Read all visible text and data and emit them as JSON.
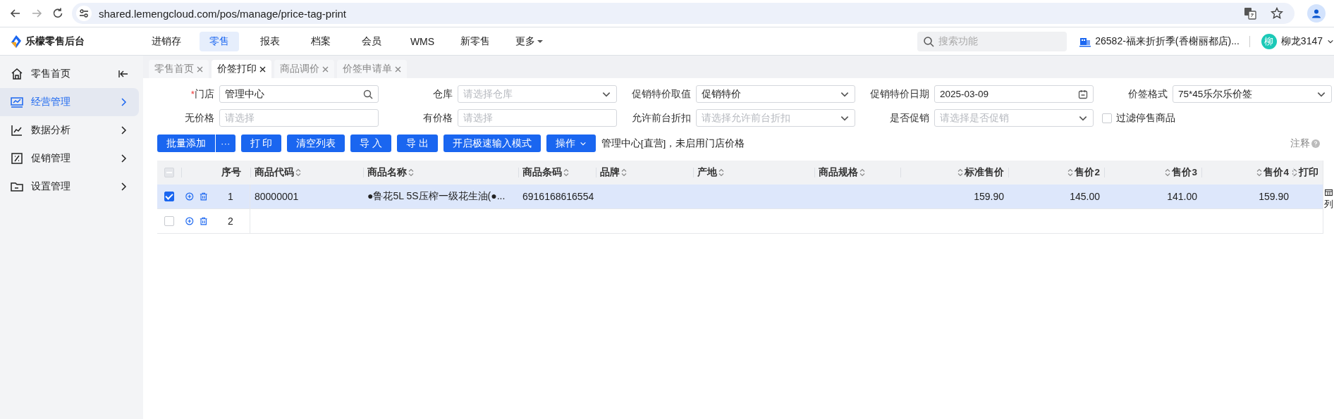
{
  "browser": {
    "url": "shared.lemengcloud.com/pos/manage/price-tag-print"
  },
  "header": {
    "brand": "乐檬零售后台",
    "nav": [
      {
        "label": "进销存",
        "selected": false,
        "kind": "link"
      },
      {
        "label": "零售",
        "selected": true,
        "kind": "link"
      },
      {
        "label": "报表",
        "selected": false,
        "kind": "link"
      },
      {
        "label": "档案",
        "selected": false,
        "kind": "link"
      },
      {
        "label": "会员",
        "selected": false,
        "kind": "link"
      },
      {
        "label": "WMS",
        "selected": false,
        "kind": "link"
      },
      {
        "label": "新零售",
        "selected": false,
        "kind": "link"
      },
      {
        "label": "更多",
        "selected": false,
        "kind": "dropdown"
      }
    ],
    "search": {
      "placeholder": "搜索功能"
    },
    "store": "26582-福来折折季(香榭丽都店)...",
    "avatar": "柳",
    "user": "柳龙3147"
  },
  "sidebar": {
    "items": [
      {
        "label": "零售首页",
        "selected": false,
        "kind": "collapse"
      },
      {
        "label": "经营管理",
        "selected": true,
        "kind": "group"
      },
      {
        "label": "数据分析",
        "selected": false,
        "kind": "group"
      },
      {
        "label": "促销管理",
        "selected": false,
        "kind": "group"
      },
      {
        "label": "设置管理",
        "selected": false,
        "kind": "group"
      }
    ]
  },
  "tabs": [
    {
      "label": "零售首页",
      "selected": false
    },
    {
      "label": "价签打印",
      "selected": true
    },
    {
      "label": "商品调价",
      "selected": false
    },
    {
      "label": "价签申请单",
      "selected": false
    }
  ],
  "form": {
    "rows": [
      [
        {
          "label": "门店",
          "required_mark": "*",
          "kind": "search",
          "value": "管理中心"
        },
        {
          "label": "仓库",
          "kind": "select",
          "placeholder": "请选择仓库"
        },
        {
          "label": "促销特价取值",
          "kind": "select",
          "value": "促销特价"
        },
        {
          "label": "促销特价日期",
          "kind": "date",
          "value": "2025-03-09"
        },
        {
          "label": "价签格式",
          "kind": "select",
          "value": "75*45乐尔乐价签"
        }
      ],
      [
        {
          "label": "无价格",
          "kind": "text",
          "placeholder": "请选择"
        },
        {
          "label": "有价格",
          "kind": "text",
          "placeholder": "请选择"
        },
        {
          "label": "允许前台折扣",
          "kind": "select",
          "placeholder": "请选择允许前台折扣"
        },
        {
          "label": "是否促销",
          "kind": "select",
          "placeholder": "请选择是否促销"
        },
        {
          "label": "过滤停售商品",
          "kind": "checkbox",
          "checked": false
        }
      ]
    ]
  },
  "toolbar": {
    "buttons": [
      {
        "label": "批量添加",
        "kind": "split",
        "more": "···"
      },
      {
        "label": "打 印",
        "kind": "plain"
      },
      {
        "label": "清空列表",
        "kind": "plain"
      },
      {
        "label": "导 入",
        "kind": "plain"
      },
      {
        "label": "导 出",
        "kind": "plain"
      },
      {
        "label": "开启极速输入模式",
        "kind": "plain"
      },
      {
        "label": "操作",
        "kind": "dropdown"
      }
    ],
    "note": "管理中心[直营]，未启用门店价格",
    "help": "注释"
  },
  "table": {
    "select_all_indeterminate": true,
    "columns": [
      {
        "label": "序号",
        "sortable": false,
        "kind": "index"
      },
      {
        "label": "商品代码",
        "sortable": true,
        "kind": "text"
      },
      {
        "label": "商品名称",
        "sortable": true,
        "kind": "text"
      },
      {
        "label": "商品条码",
        "sortable": true,
        "kind": "text"
      },
      {
        "label": "品牌",
        "sortable": true,
        "kind": "text"
      },
      {
        "label": "产地",
        "sortable": true,
        "kind": "text"
      },
      {
        "label": "商品规格",
        "sortable": true,
        "kind": "text"
      },
      {
        "label": "标准售价",
        "sortable": true,
        "kind": "number"
      },
      {
        "label": "售价2",
        "sortable": true,
        "kind": "number"
      },
      {
        "label": "售价3",
        "sortable": true,
        "kind": "number"
      },
      {
        "label": "售价4",
        "sortable": true,
        "kind": "number"
      },
      {
        "label": "打印",
        "sortable": true,
        "kind": "number"
      }
    ],
    "rows": [
      {
        "checked": true,
        "cells": [
          "1",
          "80000001",
          "●鲁花5L 5S压榨一级花生油(●...",
          "6916168616554",
          null,
          null,
          null,
          "159.90",
          "145.00",
          "141.00",
          "159.90",
          null
        ]
      },
      {
        "checked": false,
        "cells": [
          "2",
          null,
          null,
          null,
          null,
          null,
          null,
          null,
          null,
          null,
          null,
          null
        ]
      }
    ],
    "column_panel": "列"
  }
}
